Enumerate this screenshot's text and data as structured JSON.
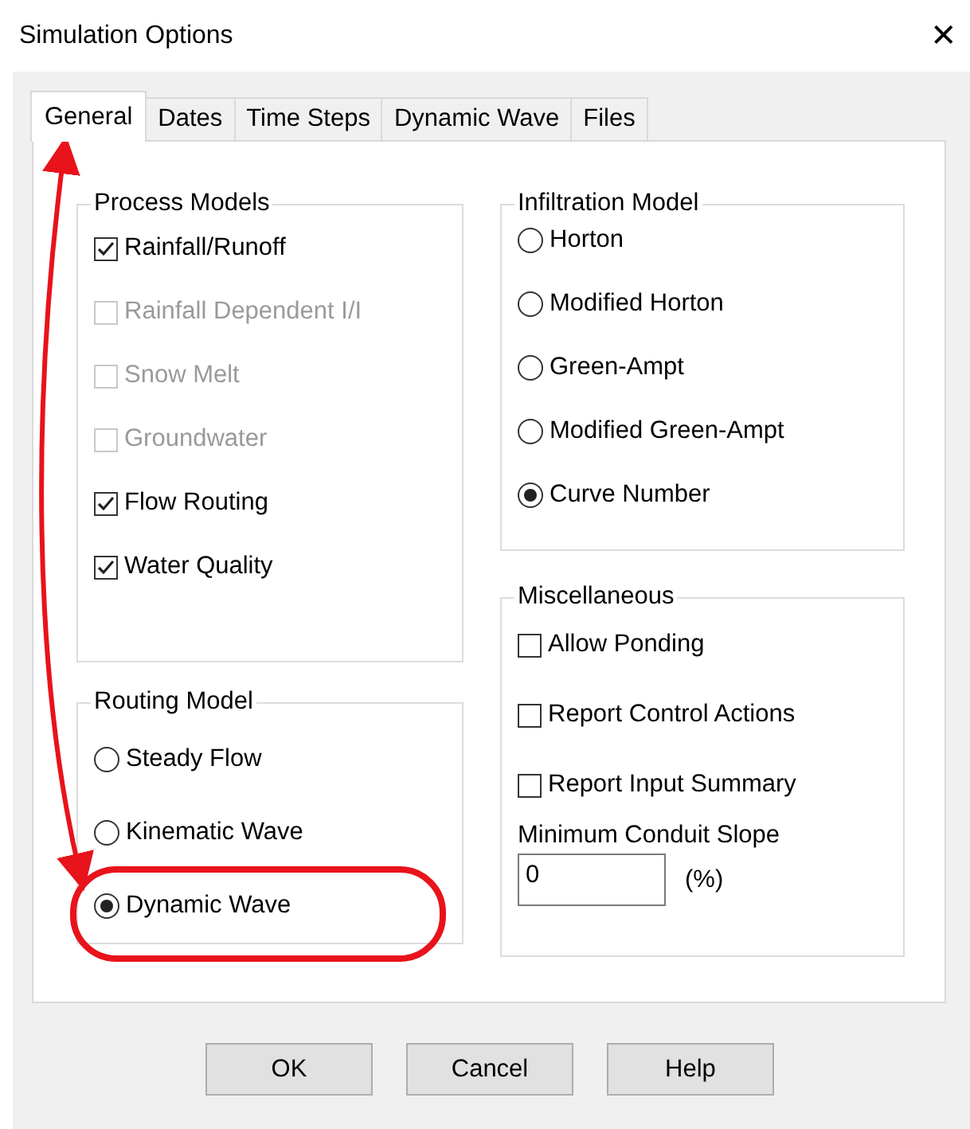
{
  "window": {
    "title": "Simulation Options",
    "close": "✕"
  },
  "tabs": [
    {
      "label": "General",
      "selected": true
    },
    {
      "label": "Dates",
      "selected": false
    },
    {
      "label": "Time Steps",
      "selected": false
    },
    {
      "label": "Dynamic Wave",
      "selected": false
    },
    {
      "label": "Files",
      "selected": false
    }
  ],
  "process_models": {
    "title": "Process Models",
    "items": [
      {
        "label": "Rainfall/Runoff",
        "checked": true,
        "disabled": false
      },
      {
        "label": "Rainfall Dependent I/I",
        "checked": false,
        "disabled": true
      },
      {
        "label": "Snow Melt",
        "checked": false,
        "disabled": true
      },
      {
        "label": "Groundwater",
        "checked": false,
        "disabled": true
      },
      {
        "label": "Flow Routing",
        "checked": true,
        "disabled": false
      },
      {
        "label": "Water Quality",
        "checked": true,
        "disabled": false
      }
    ]
  },
  "routing_model": {
    "title": "Routing Model",
    "items": [
      {
        "label": "Steady Flow",
        "selected": false
      },
      {
        "label": "Kinematic Wave",
        "selected": false
      },
      {
        "label": "Dynamic Wave",
        "selected": true
      }
    ]
  },
  "infiltration_model": {
    "title": "Infiltration Model",
    "items": [
      {
        "label": "Horton",
        "selected": false
      },
      {
        "label": "Modified Horton",
        "selected": false
      },
      {
        "label": "Green-Ampt",
        "selected": false
      },
      {
        "label": "Modified Green-Ampt",
        "selected": false
      },
      {
        "label": "Curve Number",
        "selected": true
      }
    ]
  },
  "miscellaneous": {
    "title": "Miscellaneous",
    "items": [
      {
        "label": "Allow Ponding",
        "checked": false,
        "disabled": false
      },
      {
        "label": "Report Control Actions",
        "checked": false,
        "disabled": false
      },
      {
        "label": "Report Input Summary",
        "checked": false,
        "disabled": false
      }
    ],
    "slope_label": "Minimum Conduit Slope",
    "slope_value": "0",
    "slope_unit": "(%)"
  },
  "buttons": [
    "OK",
    "Cancel",
    "Help"
  ]
}
